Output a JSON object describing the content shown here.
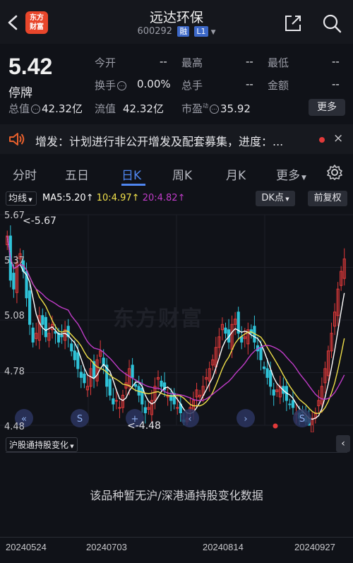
{
  "header": {
    "logo_text": "东方\n财富",
    "stock_name": "远达环保",
    "stock_code": "600292",
    "tag_margin": "融",
    "tag_level": "L1"
  },
  "quote": {
    "price": "5.42",
    "status": "停牌",
    "fields": [
      {
        "label": "今开",
        "value": "--"
      },
      {
        "label": "最高",
        "value": "--"
      },
      {
        "label": "最低",
        "value": "--"
      },
      {
        "label": "换手",
        "value": "0.00%"
      },
      {
        "label": "总手",
        "value": "--"
      },
      {
        "label": "金额",
        "value": "--"
      }
    ],
    "total_value_label": "总值",
    "total_value": "42.32亿",
    "float_value_label": "流值",
    "float_value": "42.32亿",
    "pe_label": "市盈",
    "pe_sup": "动",
    "pe_value": "35.92",
    "more_label": "更多"
  },
  "notice": {
    "text": "增发：计划进行非公开增发及配套募集，进度：...",
    "close": "×"
  },
  "tabs": [
    "分时",
    "五日",
    "日K",
    "周K",
    "月K",
    "更多"
  ],
  "active_tab": 2,
  "chart_toolbar": {
    "ma_select": "均线",
    "ma5": "MA5:5.20",
    "ma10": "10:4.97",
    "ma20": "20:4.82",
    "dk_label": "DK点",
    "adj_label": "前复权"
  },
  "chart_data": {
    "type": "candlestick",
    "y_ticks": [
      "5.67",
      "5.37",
      "5.08",
      "4.78",
      "4.48"
    ],
    "ylim": [
      4.48,
      5.67
    ],
    "high_marker": "<-5.67",
    "low_marker": "<-4.48",
    "watermark": "东方财富",
    "x_ticks": [
      "20240524",
      "20240703",
      "20240814",
      "20240927"
    ],
    "ma_colors": {
      "ma5": "#ffffff",
      "ma10": "#f0e04a",
      "ma20": "#c03cc8"
    },
    "closes": [
      5.55,
      5.3,
      5.25,
      5.4,
      5.45,
      5.35,
      5.2,
      5.05,
      4.95,
      5.0,
      5.1,
      5.05,
      4.98,
      5.0,
      5.05,
      5.0,
      4.95,
      4.98,
      5.02,
      4.98,
      4.9,
      4.85,
      4.8,
      4.75,
      4.72,
      4.7,
      4.8,
      4.75,
      4.85,
      4.9,
      4.82,
      4.7,
      4.65,
      4.6,
      4.62,
      4.58,
      4.65,
      4.72,
      4.8,
      4.75,
      4.7,
      4.65,
      4.6,
      4.55,
      4.58,
      4.62,
      4.7,
      4.75,
      4.7,
      4.68,
      4.65,
      4.62,
      4.6,
      4.58,
      4.55,
      4.5,
      4.52,
      4.58,
      4.62,
      4.68,
      4.65,
      4.7,
      4.75,
      4.8,
      4.85,
      4.92,
      4.98,
      5.05,
      5.0,
      4.95,
      5.05,
      5.08,
      5.0,
      4.95,
      4.98,
      5.02,
      5.0,
      4.95,
      4.9,
      4.85,
      4.8,
      4.75,
      4.7,
      4.65,
      4.68,
      4.7,
      4.66,
      4.62,
      4.6,
      4.58,
      4.55,
      4.52,
      4.55,
      4.5,
      4.48,
      4.52,
      4.55,
      4.62,
      4.7,
      4.8,
      4.9,
      5.0,
      5.12,
      5.25,
      5.35,
      5.42
    ],
    "arrows": [
      "«",
      "S",
      "+",
      "‹",
      "›",
      "S"
    ]
  },
  "sub_chart": {
    "select_label": "沪股通持股变化",
    "collapse": "‹",
    "message": "该品种暂无沪/深港通持股变化数据"
  },
  "colors": {
    "up": "#e23a3a",
    "down": "#2fc3d8",
    "accent": "#4f86f0",
    "bg": "#101218"
  }
}
